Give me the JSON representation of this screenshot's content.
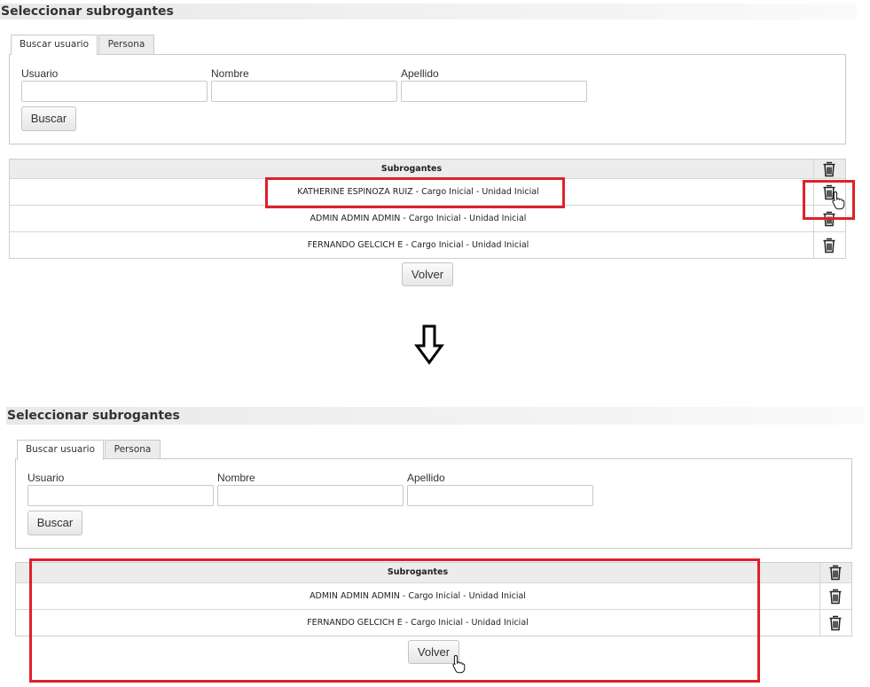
{
  "top": {
    "title": "Seleccionar subrogantes",
    "tabs": [
      "Buscar usuario",
      "Persona"
    ],
    "fields": {
      "usuario": "Usuario",
      "nombre": "Nombre",
      "apellido": "Apellido"
    },
    "search_button": "Buscar",
    "grid_header": "Subrogantes",
    "rows": [
      "KATHERINE ESPINOZA RUIZ - Cargo Inicial - Unidad Inicial",
      "ADMIN ADMIN ADMIN - Cargo Inicial - Unidad Inicial",
      "FERNANDO GELCICH E - Cargo Inicial - Unidad Inicial"
    ],
    "back_button": "Volver"
  },
  "bottom": {
    "title": "Seleccionar subrogantes",
    "tabs": [
      "Buscar usuario",
      "Persona"
    ],
    "fields": {
      "usuario": "Usuario",
      "nombre": "Nombre",
      "apellido": "Apellido"
    },
    "search_button": "Buscar",
    "grid_header": "Subrogantes",
    "rows": [
      "ADMIN ADMIN ADMIN - Cargo Inicial - Unidad Inicial",
      "FERNANDO GELCICH E - Cargo Inicial - Unidad Inicial"
    ],
    "back_button": "Volver"
  },
  "icons": {
    "delete": "trash-icon",
    "arrow": "arrow-down-icon",
    "cursor": "hand-pointer-icon"
  },
  "colors": {
    "highlight": "#e0202a",
    "header_bg": "#ececec",
    "border": "#c9c9c9"
  }
}
